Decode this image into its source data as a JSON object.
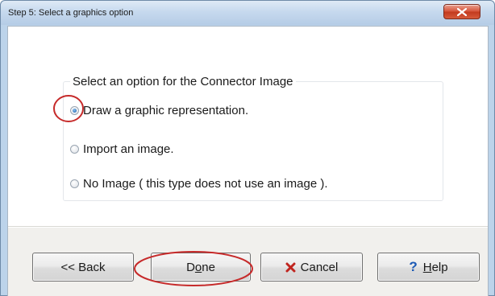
{
  "window": {
    "title": "Step 5: Select a graphics option"
  },
  "group": {
    "label": "Select an option for the Connector Image"
  },
  "options": [
    {
      "first": "D",
      "rest": "raw a graphic representation.",
      "checked": true
    },
    {
      "label": "Import an image.",
      "checked": false
    },
    {
      "label": "No Image ( this type does not use an image ).",
      "checked": false
    }
  ],
  "buttons": {
    "back": "<< Back",
    "done_pre": "D",
    "done_underline": "o",
    "done_post": "ne",
    "cancel": "Cancel",
    "help_pre": "",
    "help_underline": "H",
    "help_post": "elp"
  },
  "icons": {
    "close": "close-icon",
    "cancel": "x-icon",
    "help": "question-mark-icon"
  },
  "colors": {
    "annotation": "#c62a2a",
    "cancel_icon": "#c0251f",
    "help_icon": "#1c5ab5"
  }
}
